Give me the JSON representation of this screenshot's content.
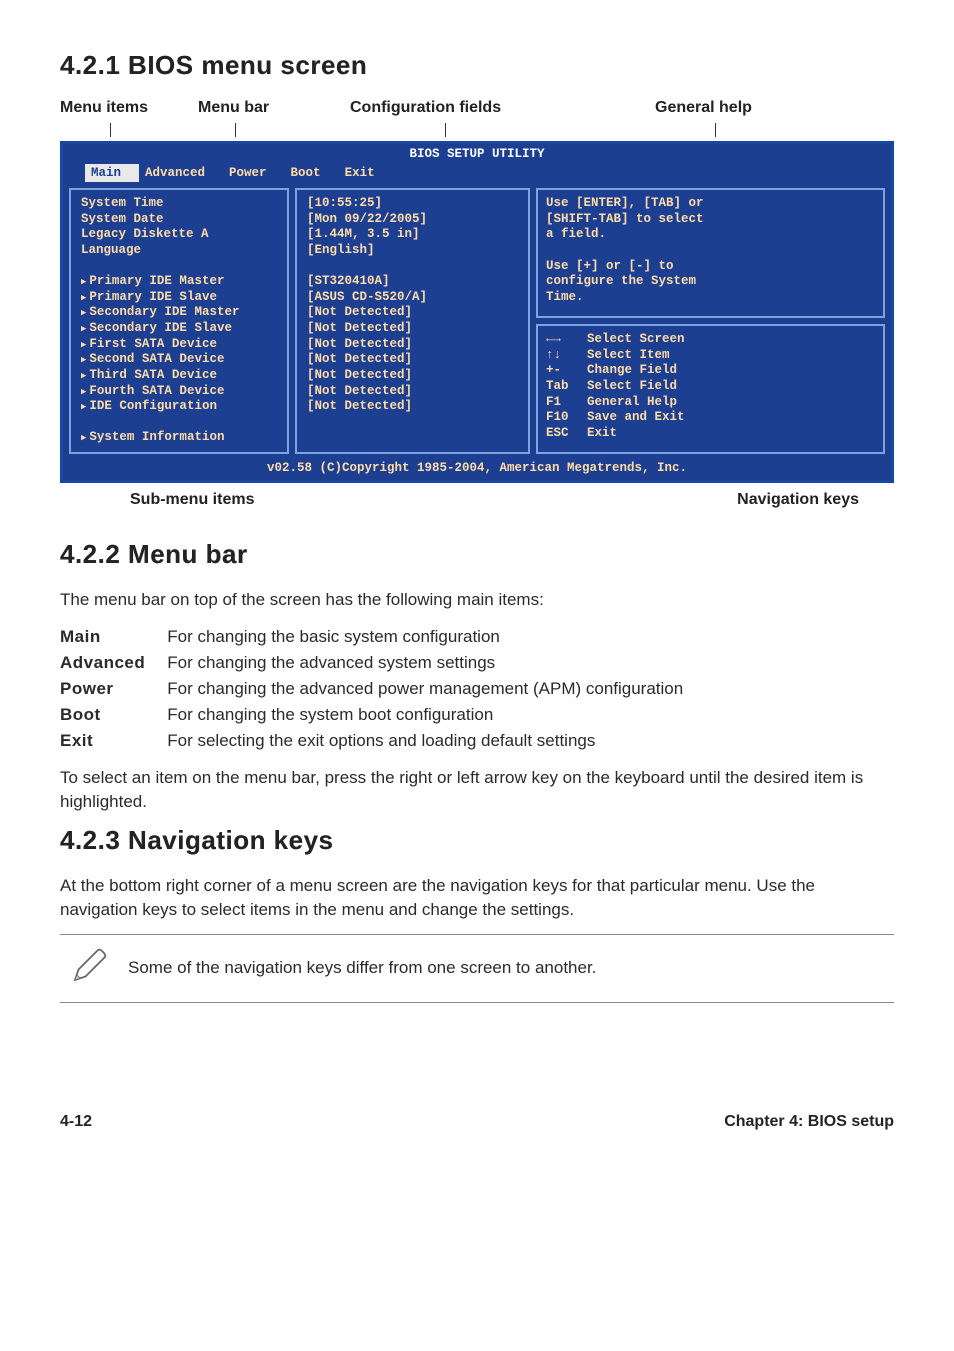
{
  "sections": {
    "s1": "4.2.1  BIOS menu screen",
    "s2": "4.2.2  Menu bar",
    "s3": "4.2.3  Navigation keys"
  },
  "callouts": {
    "menu_items": "Menu items",
    "menu_bar": "Menu bar",
    "config_fields": "Configuration fields",
    "general_help": "General help",
    "sub_menu": "Sub-menu items",
    "nav_keys": "Navigation keys"
  },
  "bios": {
    "title": "BIOS SETUP UTILITY",
    "tabs": [
      "Main",
      "Advanced",
      "Power",
      "Boot",
      "Exit"
    ],
    "left": [
      {
        "t": "System Time",
        "sub": false
      },
      {
        "t": "System Date",
        "sub": false
      },
      {
        "t": "Legacy Diskette A",
        "sub": false
      },
      {
        "t": "Language",
        "sub": false
      },
      {
        "t": "",
        "sub": false
      },
      {
        "t": "Primary IDE Master",
        "sub": true
      },
      {
        "t": "Primary IDE Slave",
        "sub": true
      },
      {
        "t": "Secondary IDE Master",
        "sub": true
      },
      {
        "t": "Secondary IDE Slave",
        "sub": true
      },
      {
        "t": "First SATA Device",
        "sub": true
      },
      {
        "t": "Second SATA Device",
        "sub": true
      },
      {
        "t": "Third SATA Device",
        "sub": true
      },
      {
        "t": "Fourth SATA Device",
        "sub": true
      },
      {
        "t": "IDE Configuration",
        "sub": true
      },
      {
        "t": "",
        "sub": false
      },
      {
        "t": "System Information",
        "sub": true
      }
    ],
    "mid": [
      "[10:55:25]",
      "[Mon 09/22/2005]",
      "[1.44M, 3.5 in]",
      "[English]",
      "",
      "[ST320410A]",
      "[ASUS CD-S520/A]",
      "[Not Detected]",
      "[Not Detected]",
      "[Not Detected]",
      "[Not Detected]",
      "[Not Detected]",
      "[Not Detected]",
      "[Not Detected]"
    ],
    "help_top": [
      "Use [ENTER], [TAB] or",
      "[SHIFT-TAB] to select",
      "a field.",
      "",
      "Use [+] or [-] to",
      "configure the System",
      "Time."
    ],
    "nav": [
      {
        "k": "←→",
        "v": "Select Screen"
      },
      {
        "k": "↑↓",
        "v": "Select Item"
      },
      {
        "k": "+-",
        "v": "Change Field"
      },
      {
        "k": "Tab",
        "v": "Select Field"
      },
      {
        "k": "F1",
        "v": "General Help"
      },
      {
        "k": "F10",
        "v": "Save and Exit"
      },
      {
        "k": "ESC",
        "v": "Exit"
      }
    ],
    "copyright": "v02.58 (C)Copyright 1985-2004, American Megatrends, Inc."
  },
  "menubar_intro": "The menu bar on top of the screen has the following main items:",
  "menubar_items": [
    {
      "k": "Main",
      "v": "For changing the basic system configuration"
    },
    {
      "k": "Advanced",
      "v": "For changing the advanced system settings"
    },
    {
      "k": "Power",
      "v": "For changing the advanced power management (APM) configuration"
    },
    {
      "k": "Boot",
      "v": "For changing the system boot configuration"
    },
    {
      "k": "Exit",
      "v": "For selecting the exit options and loading default settings"
    }
  ],
  "menubar_tail": "To select an item on the menu bar, press the right or left arrow key on the keyboard until the desired item is highlighted.",
  "navkeys_text": "At the bottom right corner of a menu screen are the navigation keys for that particular menu. Use the navigation keys to select items in the menu and change the settings.",
  "note": "Some of the navigation keys differ from one screen to another.",
  "footer": {
    "left": "4-12",
    "right": "Chapter 4: BIOS setup"
  }
}
